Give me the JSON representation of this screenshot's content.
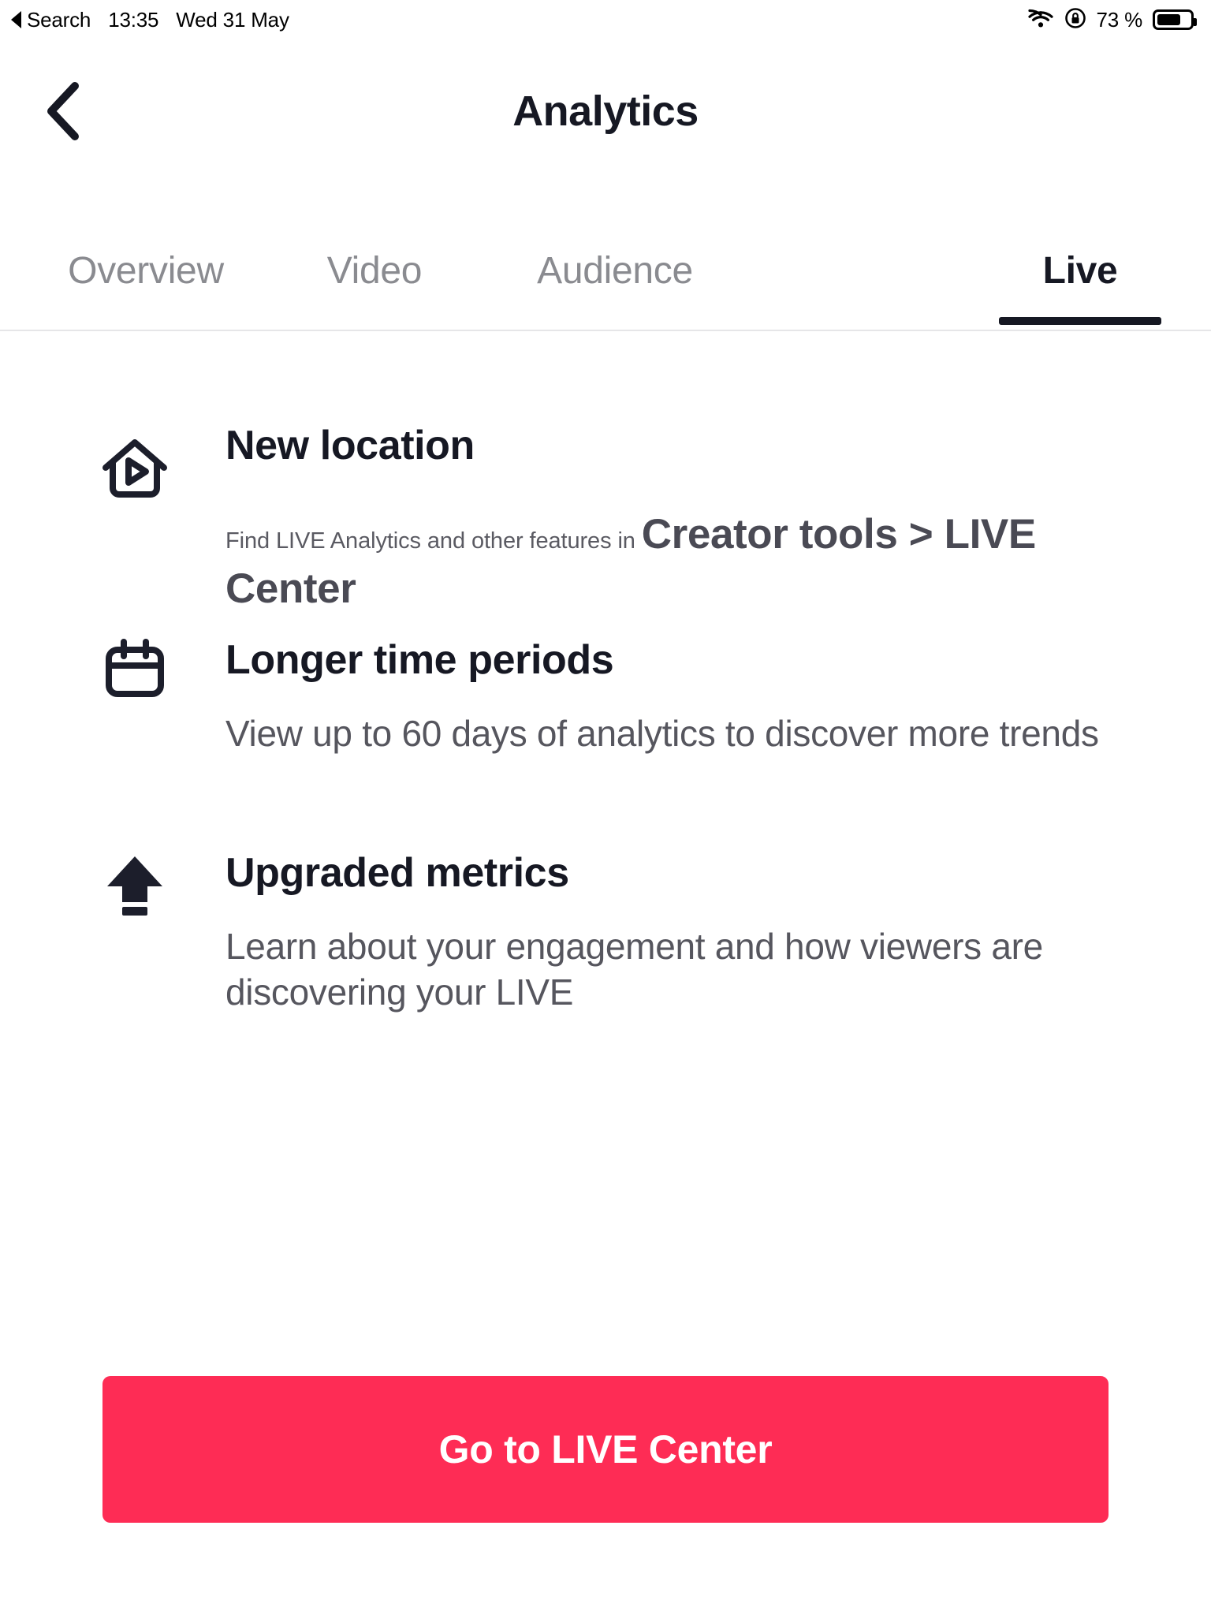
{
  "status_bar": {
    "back_label": "Search",
    "time": "13:35",
    "date": "Wed 31 May",
    "battery_percent": "73 %",
    "battery_level": 73,
    "icons": [
      "back-triangle-icon",
      "wifi-icon",
      "rotation-lock-icon",
      "battery-icon"
    ]
  },
  "header": {
    "title": "Analytics",
    "back_icon": "chevron-left-icon"
  },
  "tabs": [
    {
      "id": "overview",
      "label": "Overview",
      "active": false
    },
    {
      "id": "video",
      "label": "Video",
      "active": false
    },
    {
      "id": "audience",
      "label": "Audience",
      "active": false
    },
    {
      "id": "live",
      "label": "Live",
      "active": true
    }
  ],
  "features": [
    {
      "id": "new-location",
      "icon": "house-play-icon",
      "heading": "New location",
      "body_prefix": "Find LIVE Analytics and other features in ",
      "body_strong": "Creator tools > LIVE Center"
    },
    {
      "id": "time-periods",
      "icon": "calendar-icon",
      "heading": "Longer time periods",
      "body": "View up to 60 days of analytics to discover more trends"
    },
    {
      "id": "metrics",
      "icon": "upgrade-arrow-icon",
      "heading": "Upgraded metrics",
      "body": "Learn about your engagement and how viewers are discovering your LIVE"
    }
  ],
  "cta": {
    "label": "Go to LIVE Center",
    "color": "#fe2c55",
    "text_color": "#ffffff"
  },
  "colors": {
    "accent": "#fe2c55",
    "text_primary": "#161823",
    "text_secondary": "#56565e",
    "text_muted": "#8a8b90",
    "background": "#ffffff"
  }
}
